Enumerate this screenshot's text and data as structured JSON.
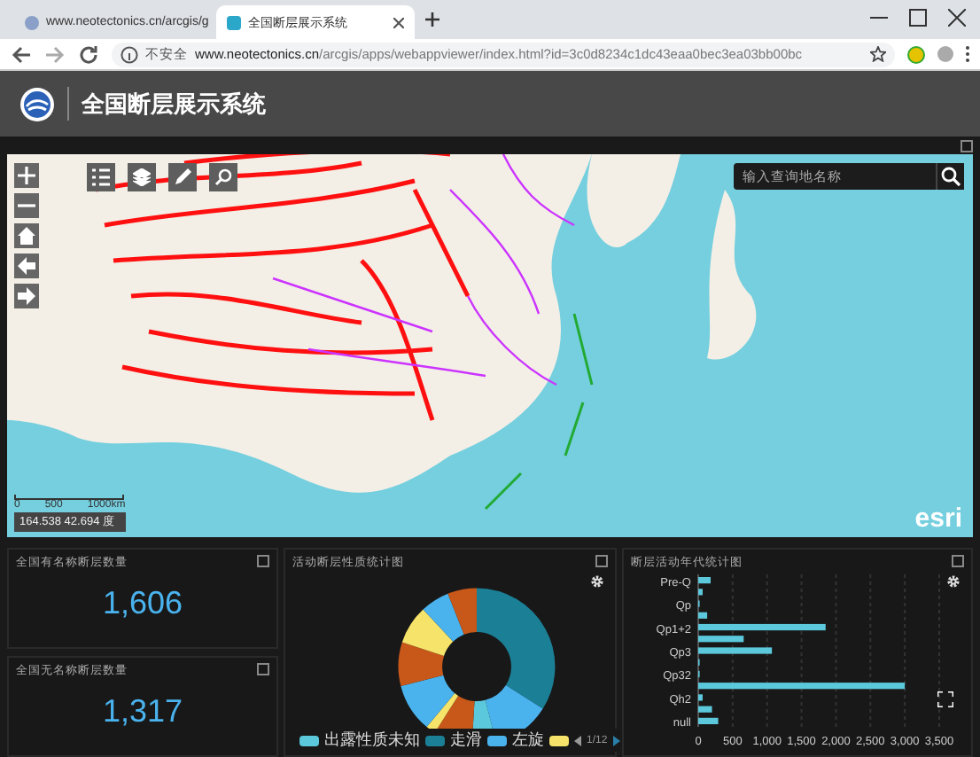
{
  "browser": {
    "tabs": [
      {
        "title": "www.neotectonics.cn/arcgis/g",
        "selected": false
      },
      {
        "title": "全国断层展示系统",
        "selected": true
      }
    ],
    "security": "不安全",
    "url_host": "www.neotectonics.cn",
    "url_path": "/arcgis/apps/webappviewer/index.html?id=3c0d8234c1dc43eaa0bec3ea03bb00bc"
  },
  "app": {
    "title": "全国断层展示系统"
  },
  "map": {
    "search": {
      "placeholder": "输入查询地名称"
    },
    "scale": {
      "ticks": [
        "0",
        "500",
        "1000km"
      ]
    },
    "coordinates": "164.538 42.694 度",
    "attribution": "esri"
  },
  "panels": [
    {
      "title": "全国有名称断层数量",
      "value": "1,606"
    },
    {
      "title": "全国无名称断层数量",
      "value": "1,317"
    }
  ],
  "pie_panel": {
    "title": "活动断层性质统计图",
    "legend": [
      {
        "label": "出露性质未知",
        "color": "#5bc8dc"
      },
      {
        "label": "走滑",
        "color": "#1b7f96"
      },
      {
        "label": "左旋",
        "color": "#4ab3ee"
      },
      {
        "color": "#f5e36a"
      }
    ],
    "page": "1/12"
  },
  "bar_panel": {
    "title": "断层活动年代统计图",
    "chart_data": {
      "type": "bar",
      "orientation": "horizontal",
      "categories": [
        "Pre-Q",
        null,
        "Qp",
        null,
        "Qp1+2",
        null,
        "Qp3",
        null,
        "Qp32",
        null,
        "Qh2",
        null,
        "null"
      ],
      "series": [
        {
          "color": "#5bc8dc",
          "values": [
            180,
            20,
            0,
            130,
            1850,
            660,
            1070,
            0,
            0,
            3000,
            20,
            200,
            290
          ]
        }
      ],
      "xlim": [
        0,
        3500
      ],
      "grid": true,
      "xticks": [
        {
          "value": 0,
          "label": "0"
        },
        {
          "value": 500,
          "label": "500"
        },
        {
          "value": 1000,
          "label": "1,000"
        },
        {
          "value": 1500,
          "label": "1,500"
        },
        {
          "value": 2000,
          "label": "2,000"
        },
        {
          "value": 2500,
          "label": "2,500"
        },
        {
          "value": 3000,
          "label": "3,000"
        },
        {
          "value": 3500,
          "label": "3,500"
        }
      ]
    }
  }
}
